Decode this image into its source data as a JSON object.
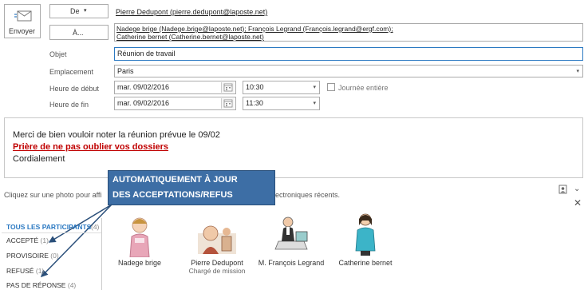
{
  "header": {
    "send_label": "Envoyer",
    "from_label": "De",
    "from_value": "Pierre Dedupont (pierre.dedupont@laposte.net)",
    "to_label": "À...",
    "to_value_line1": "Nadege brige (Nadege.brige@laposte.net); François Legrand (François.legrand@ergf.com);",
    "to_value_line2": "Catherine bernet (Catherine.bernet@laposte.net)"
  },
  "form": {
    "subject_label": "Objet",
    "subject_value": "Réunion de travail",
    "location_label": "Emplacement",
    "location_value": "Paris",
    "start_label": "Heure de début",
    "start_date": "mar. 09/02/2016",
    "start_time": "10:30",
    "allday_label": "Journée entière",
    "end_label": "Heure de fin",
    "end_date": "mar. 09/02/2016",
    "end_time": "11:30"
  },
  "body": {
    "line1": "Merci de bien vouloir noter la réunion prévue le 09/02",
    "line2": "Prière de ne pas oublier vos dossiers",
    "line3": "Cordialement"
  },
  "people_pane": {
    "hint_left": "Cliquez sur une photo pour affi",
    "hint_right": "ectroniques récents.",
    "callout_line1": "AUTOMATIQUEMENT À JOUR",
    "callout_line2": "DES ACCEPTATIONS/REFUS",
    "filters": [
      {
        "label": "TOUS LES PARTICIPANTS",
        "count": "(4)"
      },
      {
        "label": "ACCEPTÉ",
        "count": "(1)"
      },
      {
        "label": "PROVISOIRE",
        "count": "(0)"
      },
      {
        "label": "REFUSÉ",
        "count": "(1)"
      },
      {
        "label": "PAS DE RÉPONSE",
        "count": "(4)"
      }
    ],
    "participants": [
      {
        "name": "Nadege brige",
        "role": ""
      },
      {
        "name": "Pierre Dedupont",
        "role": "Chargé de mission"
      },
      {
        "name": "M. François Legrand",
        "role": ""
      },
      {
        "name": "Catherine bernet",
        "role": ""
      }
    ]
  },
  "colors": {
    "accent": "#2b79c2",
    "callout_bg": "#3d6ea5",
    "red_text": "#c00000"
  }
}
